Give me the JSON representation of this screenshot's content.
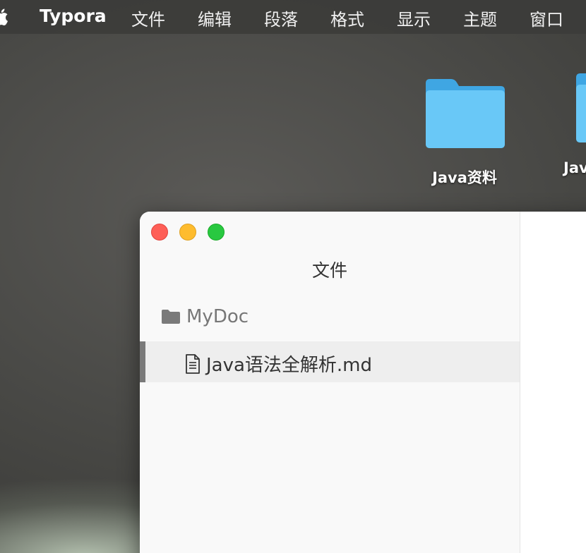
{
  "menubar": {
    "app_name": "Typora",
    "items": [
      "文件",
      "编辑",
      "段落",
      "格式",
      "显示",
      "主题",
      "窗口"
    ]
  },
  "desktop": {
    "icons": [
      {
        "label": "Java资料"
      },
      {
        "label": "Jav"
      }
    ]
  },
  "window": {
    "sidebar": {
      "title": "文件",
      "folder": {
        "name": "MyDoc"
      },
      "files": [
        {
          "name": "Java语法全解析.md",
          "selected": true
        }
      ]
    }
  },
  "colors": {
    "folder_blue": "#5ec2f5",
    "selection_bg": "#eeeeee",
    "traffic_close": "#fe5f57",
    "traffic_min": "#febc2e",
    "traffic_max": "#28c840"
  }
}
